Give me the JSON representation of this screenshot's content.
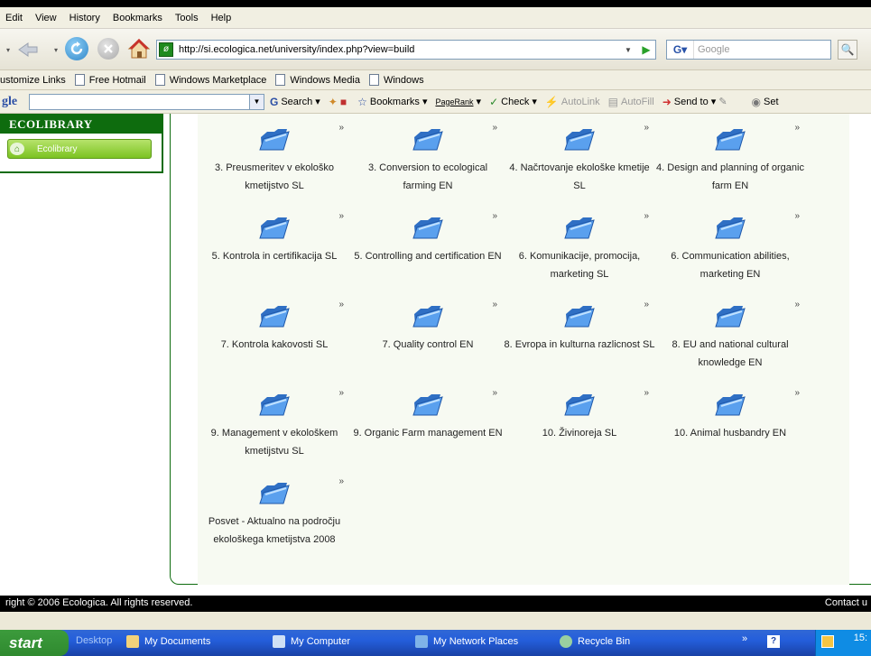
{
  "menu": [
    "Edit",
    "View",
    "History",
    "Bookmarks",
    "Tools",
    "Help"
  ],
  "address": {
    "url": "http://si.ecologica.net/university/index.php?view=build"
  },
  "search": {
    "placeholder": "Google"
  },
  "links": [
    "ustomize Links",
    "Free Hotmail",
    "Windows Marketplace",
    "Windows Media",
    "Windows"
  ],
  "google_toolbar": {
    "logo": "gle",
    "search": "Search",
    "bookmarks": "Bookmarks",
    "pagerank": "PageRank",
    "check": "Check",
    "autolink": "AutoLink",
    "autofill": "AutoFill",
    "sendto": "Send to",
    "settings": "Set"
  },
  "sidebar": {
    "heading": "ECOLIBRARY",
    "button": "Ecolibrary"
  },
  "categories": [
    "3. Preusmeritev v ekološko kmetijstvo SL",
    "3. Conversion to ecological farming EN",
    "4. Načrtovanje ekološke kmetije SL",
    "4. Design and planning of organic farm EN",
    "5. Kontrola in certifikacija SL",
    "5. Controlling and certification EN",
    "6. Komunikacije, promocija, marketing SL",
    "6. Communication abilities, marketing EN",
    "7. Kontrola kakovosti SL",
    "7. Quality control EN",
    "8. Evropa in kulturna razlicnost SL",
    "8. EU and national cultural knowledge EN",
    "9. Management v ekološkem kmetijstvu SL",
    "9. Organic Farm management EN",
    "10. Živinoreja SL",
    "10. Animal husbandry EN",
    "Posvet - Aktualno na področju ekološkega kmetijstva 2008"
  ],
  "footer": {
    "copyright": "right © 2006 Ecologica. All rights reserved.",
    "contact": "Contact u"
  },
  "taskbar": {
    "start": "start",
    "items": [
      "Desktop",
      "My Documents",
      "My Computer",
      "My Network Places",
      "Recycle Bin"
    ],
    "time": "15:"
  },
  "colors": {
    "brand_green": "#0e6c0e",
    "button_green": "#7cc322",
    "folder_blue": "#3b7fd6",
    "taskbar_blue": "#245edb"
  }
}
